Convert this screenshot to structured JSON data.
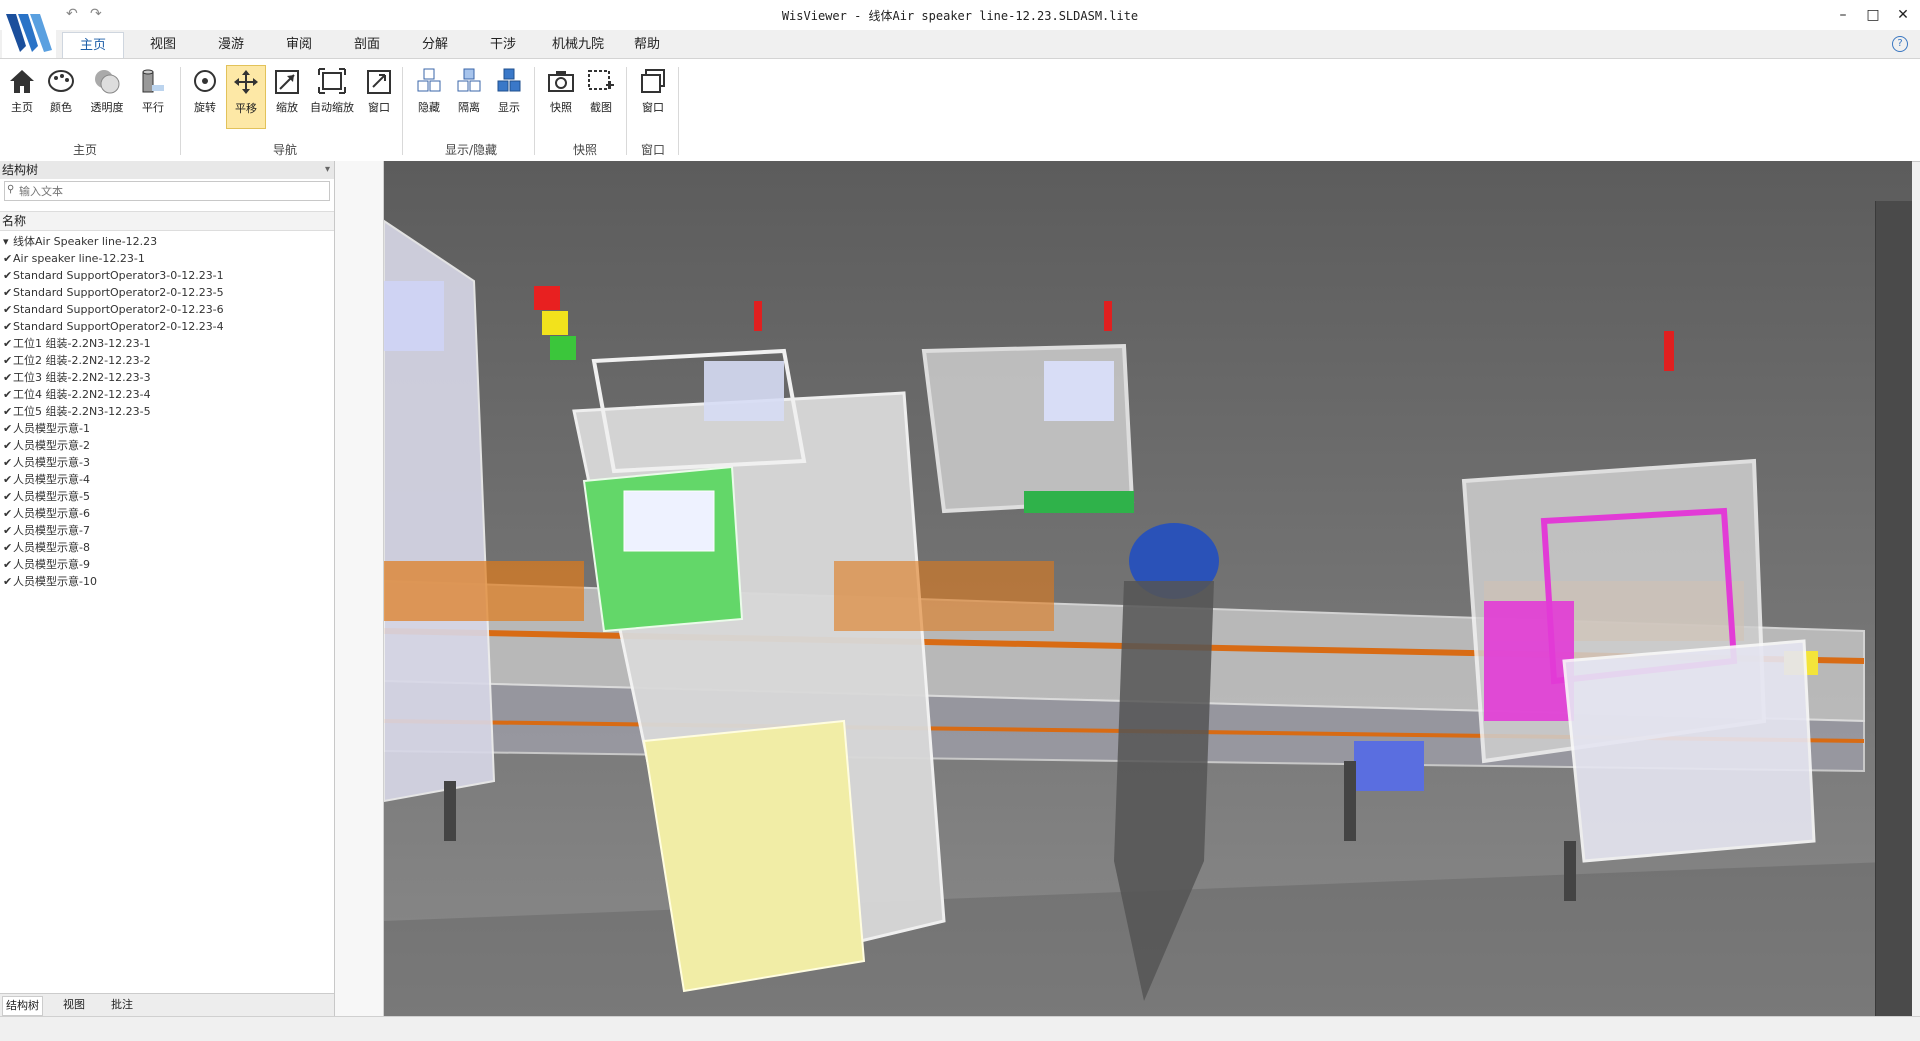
{
  "window": {
    "title": "WisViewer - 线体Air speaker line-12.23.SLDASM.lite",
    "undo_icon": "undo-icon",
    "redo_icon": "redo-icon",
    "minimize": "–",
    "maximize": "□",
    "close": "✕",
    "help_glyph": "?"
  },
  "tabs": [
    "主页",
    "视图",
    "漫游",
    "审阅",
    "剖面",
    "分解",
    "干涉",
    "机械九院",
    "帮助"
  ],
  "ribbon": {
    "buttons": {
      "home": "主页",
      "color": "颜色",
      "transparency": "透明度",
      "parallel": "平行",
      "rotate": "旋转",
      "pan": "平移",
      "zoom": "缩放",
      "zoom_fit": "自动缩放",
      "zoom_window": "窗口",
      "hide": "隐藏",
      "isolate": "隔离",
      "show": "显示",
      "snapshot": "快照",
      "area_capture": "截图",
      "window_btn": "窗口"
    },
    "groups": {
      "home": "主页",
      "navigate": "导航",
      "display_hide": "显示/隐藏",
      "snapshot": "快照",
      "window": "窗口"
    }
  },
  "left_panel": {
    "title": "结构树",
    "search_placeholder": "输入文本",
    "column_header": "名称",
    "items": [
      "线体Air Speaker line-12.23",
      "Air speaker line-12.23-1",
      "Standard SupportOperator3-0-12.23-1",
      "Standard SupportOperator2-0-12.23-5",
      "Standard SupportOperator2-0-12.23-6",
      "Standard SupportOperator2-0-12.23-4",
      "工位1 组装-2.2N3-12.23-1",
      "工位2 组装-2.2N2-12.23-2",
      "工位3 组装-2.2N2-12.23-3",
      "工位4 组装-2.2N2-12.23-4",
      "工位5 组装-2.2N3-12.23-5",
      "人员模型示意-1",
      "人员模型示意-2",
      "人员模型示意-3",
      "人员模型示意-4",
      "人员模型示意-5",
      "人员模型示意-6",
      "人员模型示意-7",
      "人员模型示意-8",
      "人员模型示意-9",
      "人员模型示意-10"
    ],
    "bottom_tabs": [
      "结构树",
      "视图",
      "批注"
    ]
  },
  "colors": {
    "ribbon_active": "#fde8a6",
    "tab_active_text": "#1e5fa8",
    "viewport_bg": "#6a6a6a",
    "machine_green": "#58d36a",
    "machine_magenta": "#e23bd6",
    "machine_orange": "#e07a1a",
    "machine_yellow": "#f3f0a8"
  }
}
